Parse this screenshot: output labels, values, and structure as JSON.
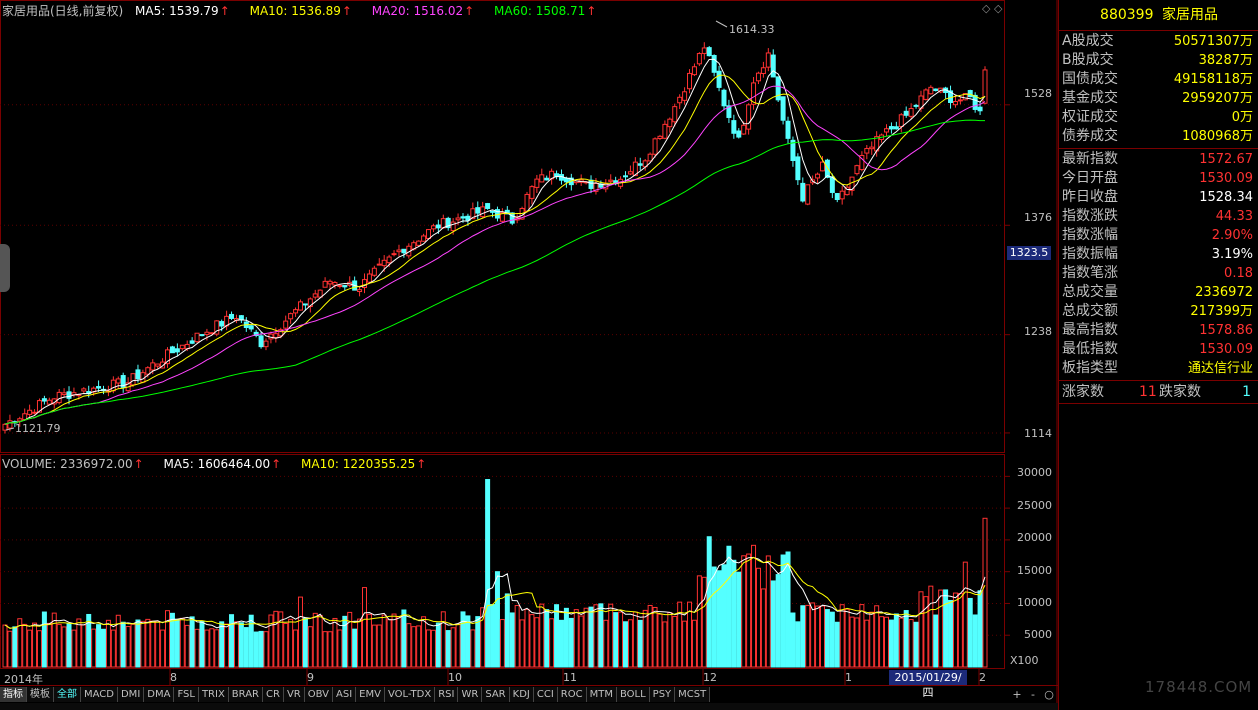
{
  "header": {
    "title": "家居用品(日线,前复权)",
    "ma5": "MA5: 1539.79",
    "ma10": "MA10: 1536.89",
    "ma20": "MA20: 1516.02",
    "ma60": "MA60: 1508.71"
  },
  "vol_header": {
    "volume": "VOLUME: 2336972.00",
    "ma5": "MA5: 1606464.00",
    "ma10": "MA10: 1220355.25"
  },
  "price_axis": [
    "1528",
    "1376",
    "1238",
    "1114"
  ],
  "vol_axis": [
    "30000",
    "25000",
    "20000",
    "15000",
    "10000",
    "5000"
  ],
  "vol_unit": "X100",
  "current_price_tag": "1323.5",
  "annotations": {
    "high": "1614.33",
    "low": "1121.79"
  },
  "months": [
    "2014年",
    "8",
    "9",
    "10",
    "11",
    "12",
    "1",
    "2"
  ],
  "selected_date": "2015/01/29/四",
  "colors": {
    "up": "#ff3232",
    "down": "#54ffff",
    "ma5": "#ffffff",
    "ma10": "#ffff00",
    "ma20": "#ff44ff",
    "ma60": "#00ff00",
    "border": "#7a0000"
  },
  "panel": {
    "code": "880399",
    "name": "家居用品",
    "trade": [
      {
        "k": "A股成交",
        "v": "50571307万"
      },
      {
        "k": "B股成交",
        "v": "38287万"
      },
      {
        "k": "国债成交",
        "v": "49158118万"
      },
      {
        "k": "基金成交",
        "v": "2959207万"
      },
      {
        "k": "权证成交",
        "v": "0万"
      },
      {
        "k": "债券成交",
        "v": "1080968万"
      }
    ],
    "stats": [
      {
        "k": "最新指数",
        "v": "1572.67",
        "c": "red"
      },
      {
        "k": "今日开盘",
        "v": "1530.09",
        "c": "red"
      },
      {
        "k": "昨日收盘",
        "v": "1528.34",
        "c": "white"
      },
      {
        "k": "指数涨跌",
        "v": "44.33",
        "c": "red"
      },
      {
        "k": "指数涨幅",
        "v": "2.90%",
        "c": "red"
      },
      {
        "k": "指数振幅",
        "v": "3.19%",
        "c": "white"
      },
      {
        "k": "指数笔涨",
        "v": "0.18",
        "c": "red"
      },
      {
        "k": "总成交量",
        "v": "2336972",
        "c": "yellow"
      },
      {
        "k": "总成交额",
        "v": "217399万",
        "c": "yellow"
      },
      {
        "k": "最高指数",
        "v": "1578.86",
        "c": "red"
      },
      {
        "k": "最低指数",
        "v": "1530.09",
        "c": "red"
      },
      {
        "k": "板指类型",
        "v": "通达信行业",
        "c": "yellow"
      }
    ],
    "up_label": "涨家数",
    "up_count": "11",
    "down_label": "跌家数",
    "down_count": "1"
  },
  "tabs": [
    "指标",
    "模板",
    "全部",
    "MACD",
    "DMI",
    "DMA",
    "FSL",
    "TRIX",
    "BRAR",
    "CR",
    "VR",
    "OBV",
    "ASI",
    "EMV",
    "VOL-TDX",
    "RSI",
    "WR",
    "SAR",
    "KDJ",
    "CCI",
    "ROC",
    "MTM",
    "BOLL",
    "PSY",
    "MCST"
  ],
  "zoom": {
    "plus": "+",
    "minus": "-",
    "circle": "○"
  },
  "watermark": "178448.COM",
  "chart_data": {
    "type": "candlestick",
    "price_ticks": [
      1114,
      1238,
      1376,
      1528
    ],
    "volume_ticks": [
      5000,
      10000,
      15000,
      20000,
      25000,
      30000
    ],
    "anchors": [
      {
        "i": 0,
        "c": 1125
      },
      {
        "i": 10,
        "c": 1160
      },
      {
        "i": 20,
        "c": 1172
      },
      {
        "i": 25,
        "c": 1178
      },
      {
        "i": 30,
        "c": 1200
      },
      {
        "i": 40,
        "c": 1240
      },
      {
        "i": 47,
        "c": 1262
      },
      {
        "i": 52,
        "c": 1228
      },
      {
        "i": 58,
        "c": 1262
      },
      {
        "i": 66,
        "c": 1306
      },
      {
        "i": 72,
        "c": 1298
      },
      {
        "i": 80,
        "c": 1344
      },
      {
        "i": 88,
        "c": 1376
      },
      {
        "i": 95,
        "c": 1390
      },
      {
        "i": 98,
        "c": 1396
      },
      {
        "i": 103,
        "c": 1382
      },
      {
        "i": 108,
        "c": 1432
      },
      {
        "i": 112,
        "c": 1442
      },
      {
        "i": 118,
        "c": 1426
      },
      {
        "i": 125,
        "c": 1436
      },
      {
        "i": 130,
        "c": 1462
      },
      {
        "i": 136,
        "c": 1526
      },
      {
        "i": 142,
        "c": 1602
      },
      {
        "i": 146,
        "c": 1530
      },
      {
        "i": 149,
        "c": 1482
      },
      {
        "i": 152,
        "c": 1560
      },
      {
        "i": 155,
        "c": 1592
      },
      {
        "i": 159,
        "c": 1480
      },
      {
        "i": 162,
        "c": 1412
      },
      {
        "i": 166,
        "c": 1450
      },
      {
        "i": 169,
        "c": 1402
      },
      {
        "i": 174,
        "c": 1460
      },
      {
        "i": 178,
        "c": 1488
      },
      {
        "i": 183,
        "c": 1514
      },
      {
        "i": 188,
        "c": 1550
      },
      {
        "i": 193,
        "c": 1534
      },
      {
        "i": 196,
        "c": 1536
      },
      {
        "i": 198,
        "c": 1518
      },
      {
        "i": 199,
        "c": 1572
      }
    ],
    "count": 200
  }
}
